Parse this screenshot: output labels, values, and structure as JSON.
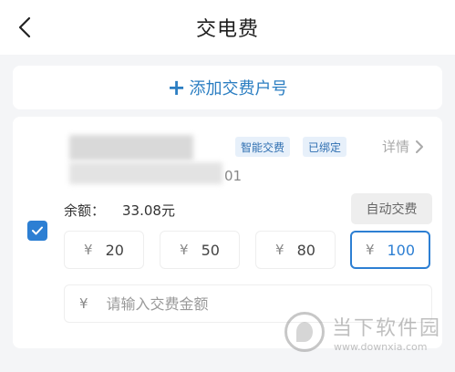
{
  "header": {
    "title": "交电费",
    "back_icon": "chevron-left-icon"
  },
  "add_account": {
    "plus": "+",
    "label": "添加交费户号"
  },
  "account": {
    "tags": [
      "智能交费",
      "已绑定"
    ],
    "detail_label": "详情",
    "account_no_visible": "01",
    "balance_label": "余额：",
    "balance_value": "33.08元",
    "auto_pay_label": "自动交费",
    "checked": true,
    "currency_symbol": "¥",
    "amounts": [
      "20",
      "50",
      "80",
      "100"
    ],
    "selected_amount": "100",
    "custom_amount_placeholder": "请输入交费金额"
  },
  "watermark": {
    "name": "当下软件园",
    "url": "www.downxia.com"
  },
  "colors": {
    "accent": "#2d7fd3",
    "add_text": "#2b7ec2",
    "tag_bg": "#e7f0fa",
    "tag_text": "#2f6fb1",
    "background": "#f4f5f7"
  }
}
